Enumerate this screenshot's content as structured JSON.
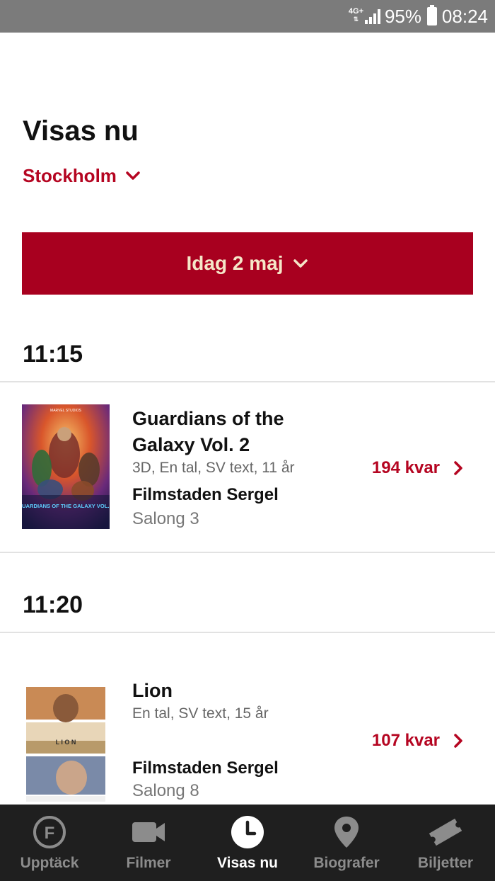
{
  "status_bar": {
    "network": "4G+",
    "battery": "95%",
    "time": "08:24"
  },
  "header": {
    "title": "Visas nu",
    "city": "Stockholm"
  },
  "date_selector": {
    "label": "Idag 2 maj"
  },
  "showings": [
    {
      "time": "11:15",
      "movie": "Guardians of the Galaxy Vol. 2",
      "details": "3D, En tal, SV text, 11 år",
      "cinema": "Filmstaden Sergel",
      "hall": "Salong 3",
      "seats": "194 kvar",
      "poster_text": "GUARDIANS OF THE GALAXY VOL. 2",
      "poster_brand": "MARVEL STUDIOS"
    },
    {
      "time": "11:20",
      "movie": "Lion",
      "details": "En tal, SV text, 15 år",
      "cinema": "Filmstaden Sergel",
      "hall": "Salong 8",
      "seats": "107 kvar",
      "poster_text": "L I O N"
    }
  ],
  "bottom_nav": {
    "items": [
      {
        "label": "Upptäck",
        "icon": "f-logo-icon",
        "active": false
      },
      {
        "label": "Filmer",
        "icon": "video-camera-icon",
        "active": false
      },
      {
        "label": "Visas nu",
        "icon": "clock-icon",
        "active": true
      },
      {
        "label": "Biografer",
        "icon": "map-pin-icon",
        "active": false
      },
      {
        "label": "Biljetter",
        "icon": "ticket-icon",
        "active": false
      }
    ]
  },
  "colors": {
    "accent": "#b50521",
    "button_bg": "#a8001f",
    "button_text": "#f5e6c8",
    "nav_bg": "#1f1f1f",
    "status_bg": "#7b7b7b"
  }
}
